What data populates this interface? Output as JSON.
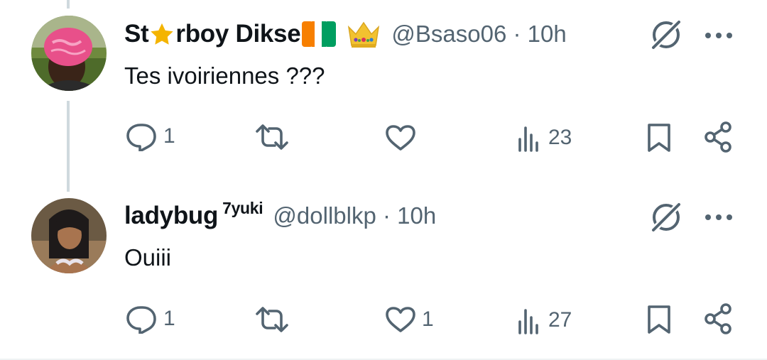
{
  "tweets": [
    {
      "name_start": "St",
      "name_end": "rboy Dikse",
      "handle_time": "@Bsaso06 · 10h",
      "text": "Tes ivoiriennes ???",
      "replies": "1",
      "reposts": "",
      "likes": "",
      "views": "23"
    },
    {
      "name": "ladybug",
      "name_suffix": "7yuki",
      "handle_time": "@dollblkp · 10h",
      "text": "Ouiii",
      "replies": "1",
      "reposts": "",
      "likes": "1",
      "views": "27"
    }
  ],
  "icons": {
    "reply": "reply-icon",
    "repost": "repost-icon",
    "like": "like-icon",
    "views": "views-icon",
    "bookmark": "bookmark-icon",
    "share": "share-icon",
    "grok": "grok-icon",
    "more": "more-icon"
  },
  "colors": {
    "text": "#0f1419",
    "secondary": "#536471",
    "thread_line": "#cfd9de",
    "star": "#f4b400",
    "crown": "#f2c230",
    "flag_orange": "#f77f00",
    "flag_green": "#009e60"
  }
}
